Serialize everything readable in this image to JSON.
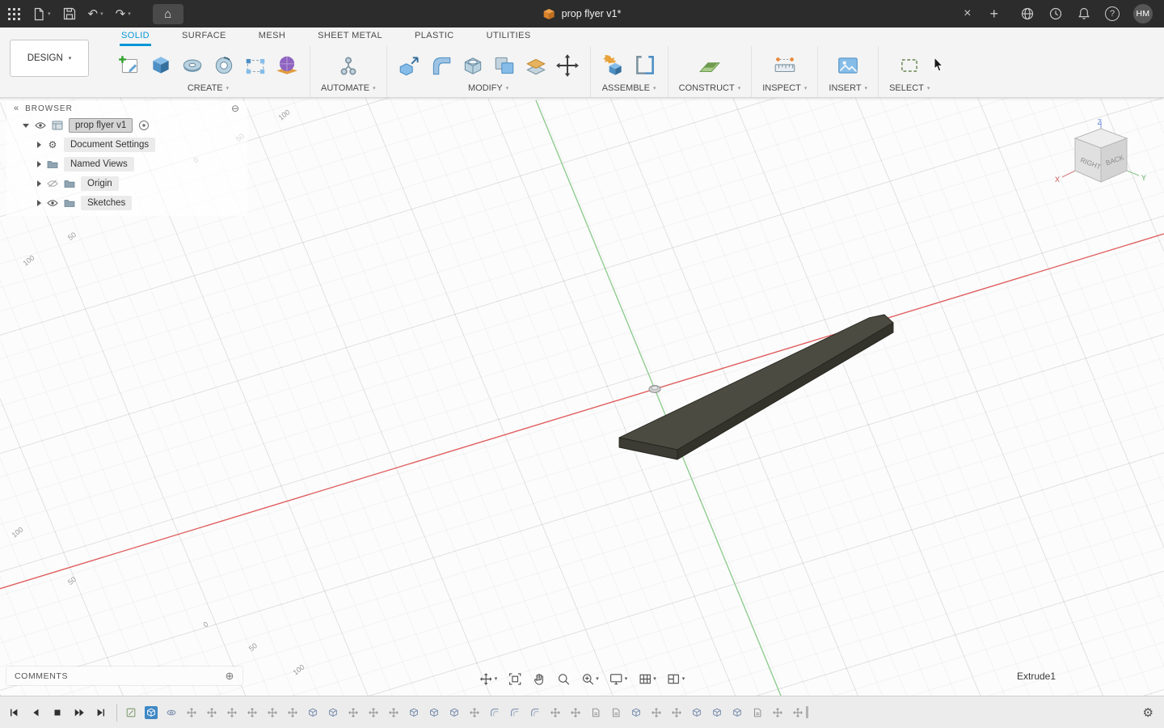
{
  "topbar": {
    "title": "prop flyer v1*",
    "avatar": "HM"
  },
  "icons": {
    "caret_down": "▾",
    "close": "×",
    "plus": "+",
    "home": "⌂",
    "undo": "↶",
    "redo": "↷",
    "gear": "⚙",
    "circle_minus": "⊖",
    "circle_plus": "⊕",
    "collapse": "«",
    "help": "?"
  },
  "menu": {
    "design": "DESIGN"
  },
  "tabs": [
    {
      "label": "SOLID",
      "active": true
    },
    {
      "label": "SURFACE"
    },
    {
      "label": "MESH"
    },
    {
      "label": "SHEET METAL"
    },
    {
      "label": "PLASTIC"
    },
    {
      "label": "UTILITIES"
    }
  ],
  "groups": [
    {
      "label": "CREATE"
    },
    {
      "label": "AUTOMATE"
    },
    {
      "label": "MODIFY"
    },
    {
      "label": "ASSEMBLE"
    },
    {
      "label": "CONSTRUCT"
    },
    {
      "label": "INSPECT"
    },
    {
      "label": "INSERT"
    },
    {
      "label": "SELECT"
    }
  ],
  "browser": {
    "header": "BROWSER",
    "rows": [
      {
        "label": "prop flyer v1",
        "selected": true
      },
      {
        "label": "Document Settings"
      },
      {
        "label": "Named Views"
      },
      {
        "label": "Origin",
        "hidden": true
      },
      {
        "label": "Sketches"
      }
    ]
  },
  "viewport": {
    "feature_label": "Extrude1",
    "ruler_labels": [
      {
        "t": "100"
      },
      {
        "t": "50"
      },
      {
        "t": "0"
      },
      {
        "t": "50"
      },
      {
        "t": "100"
      },
      {
        "t": "100"
      },
      {
        "t": "50"
      },
      {
        "t": "0"
      },
      {
        "t": "50"
      },
      {
        "t": "100"
      }
    ],
    "viewcube": {
      "faces": {
        "left": "RIGHT",
        "right": "BACK"
      },
      "axes": {
        "x": "X",
        "y": "Y",
        "z": "Z"
      }
    }
  },
  "comments": {
    "label": "COMMENTS"
  },
  "timeline": {
    "features": [
      {
        "type": "sketch"
      },
      {
        "type": "extrude",
        "active": true
      },
      {
        "type": "revolve"
      },
      {
        "type": "move"
      },
      {
        "type": "move"
      },
      {
        "type": "move"
      },
      {
        "type": "move"
      },
      {
        "type": "move"
      },
      {
        "type": "move"
      },
      {
        "type": "extrude"
      },
      {
        "type": "extrude"
      },
      {
        "type": "move"
      },
      {
        "type": "move"
      },
      {
        "type": "move"
      },
      {
        "type": "extrude"
      },
      {
        "type": "extrude"
      },
      {
        "type": "extrude"
      },
      {
        "type": "move"
      },
      {
        "type": "fillet"
      },
      {
        "type": "fillet"
      },
      {
        "type": "fillet"
      },
      {
        "type": "move"
      },
      {
        "type": "move"
      },
      {
        "type": "doc"
      },
      {
        "type": "doc"
      },
      {
        "type": "extrude"
      },
      {
        "type": "move"
      },
      {
        "type": "move"
      },
      {
        "type": "extrude"
      },
      {
        "type": "extrude"
      },
      {
        "type": "extrude"
      },
      {
        "type": "doc"
      },
      {
        "type": "move"
      },
      {
        "type": "move"
      }
    ]
  },
  "colors": {
    "accent": "#0696d7",
    "axis_x": "#e06060",
    "axis_y": "#8fcc8f",
    "part_top": "#4b4b42",
    "part_side": "#33332c"
  }
}
